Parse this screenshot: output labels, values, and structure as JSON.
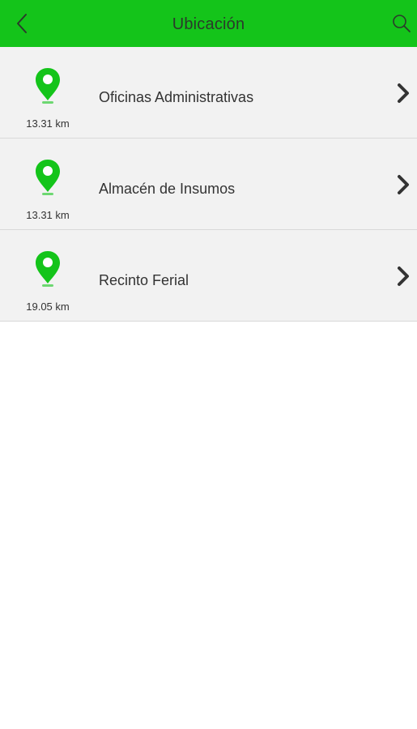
{
  "header": {
    "title": "Ubicación",
    "back_icon": "chevron-left-icon",
    "search_icon": "search-icon",
    "background_color": "#14c41a"
  },
  "locations": [
    {
      "name": "Oficinas Administrativas",
      "distance": "13.31 km"
    },
    {
      "name": "Almacén de Insumos",
      "distance": "13.31 km"
    },
    {
      "name": "Recinto Ferial",
      "distance": "19.05 km"
    }
  ],
  "pin_color": "#14c41a"
}
